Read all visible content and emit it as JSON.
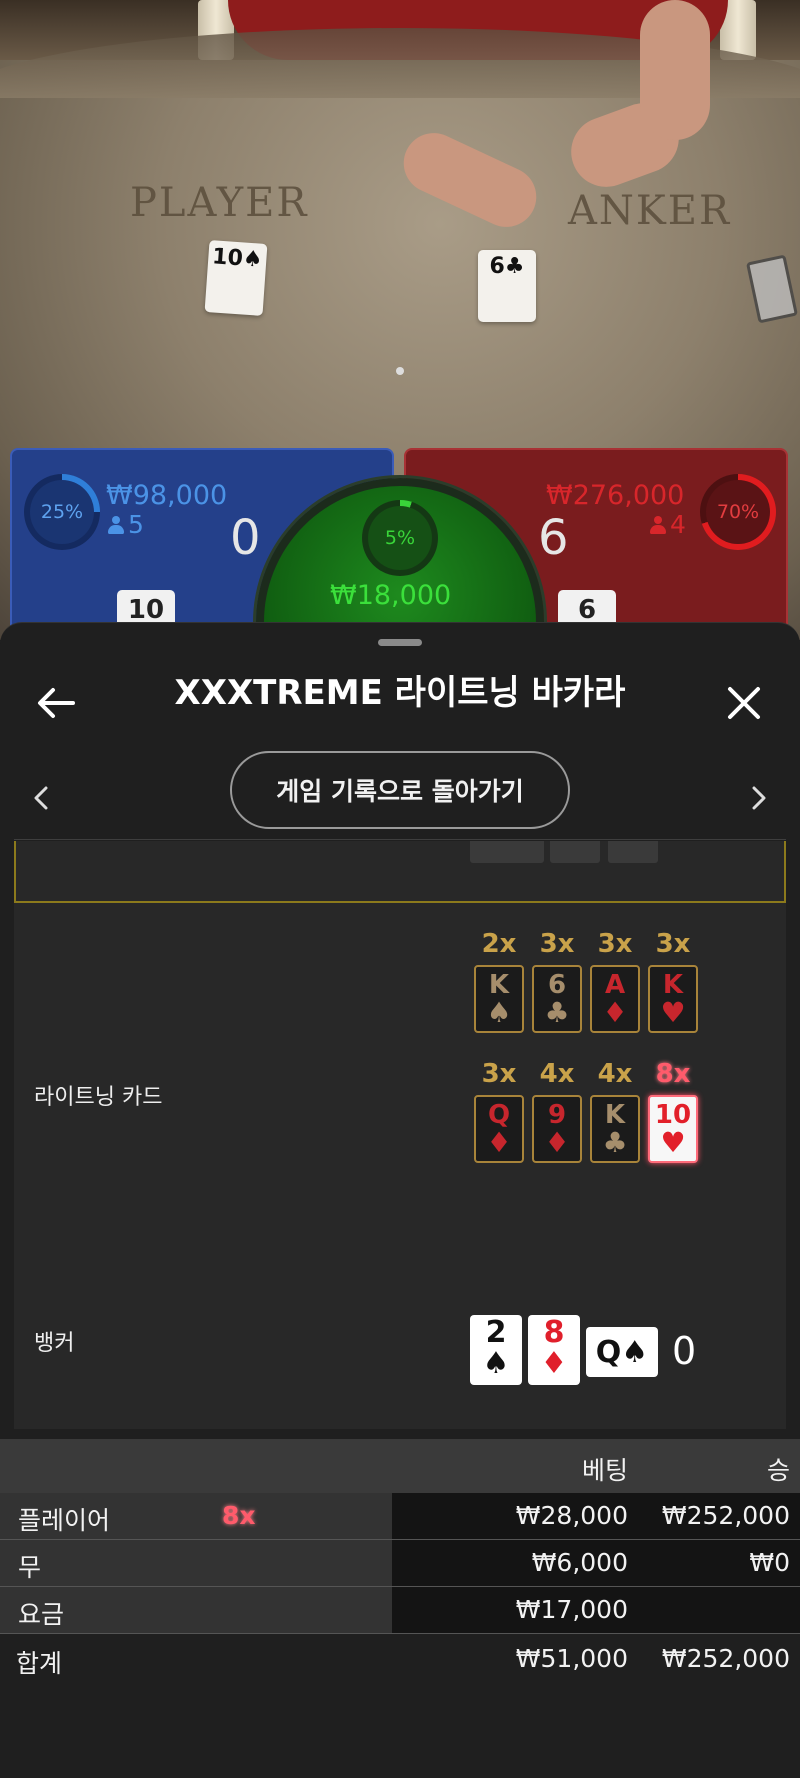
{
  "video": {
    "player_label": "PLAYER",
    "banker_label": "ANKER",
    "player_card": "10♠",
    "banker_card": "6♣"
  },
  "player_panel": {
    "percent": "25%",
    "amount": "₩98,000",
    "count": "5",
    "score": "0",
    "card": "10",
    "color": "#24408a"
  },
  "banker_panel": {
    "percent": "70%",
    "amount": "₩276,000",
    "count": "4",
    "score": "6",
    "card": "6",
    "color": "#7a1c1e"
  },
  "tie_panel": {
    "percent": "5%",
    "amount": "₩18,000",
    "color": "#1e8a1e"
  },
  "sheet": {
    "title": "XXXTREME 라이트닝 바카라",
    "back_icon": "arrow-left-icon",
    "close_icon": "close-icon",
    "return_button": "게임 기록으로 돌아가기"
  },
  "lightning": {
    "label": "라이트닝 카드",
    "cards": [
      {
        "mult": "2x",
        "rank": "K",
        "suit": "♠",
        "color": "dark"
      },
      {
        "mult": "3x",
        "rank": "6",
        "suit": "♣",
        "color": "dark"
      },
      {
        "mult": "3x",
        "rank": "A",
        "suit": "♦",
        "color": "red"
      },
      {
        "mult": "3x",
        "rank": "K",
        "suit": "♥",
        "color": "red"
      },
      {
        "mult": "3x",
        "rank": "Q",
        "suit": "♦",
        "color": "red"
      },
      {
        "mult": "4x",
        "rank": "9",
        "suit": "♦",
        "color": "red"
      },
      {
        "mult": "4x",
        "rank": "K",
        "suit": "♣",
        "color": "dark"
      },
      {
        "mult": "8x",
        "rank": "10",
        "suit": "♥",
        "color": "hot"
      }
    ]
  },
  "banker_row": {
    "label": "뱅커",
    "cards": [
      {
        "rank": "2",
        "suit": "♠",
        "color": "blk"
      },
      {
        "rank": "8",
        "suit": "♦",
        "color": "red"
      }
    ],
    "horizontal_card": "Q♠",
    "score": "0"
  },
  "results": {
    "headers": {
      "bet": "베팅",
      "win": "승"
    },
    "rows": [
      {
        "label": "플레이어",
        "mult": "8x",
        "bet": "₩28,000",
        "win": "₩252,000"
      },
      {
        "label": "무",
        "mult": "",
        "bet": "₩6,000",
        "win": "₩0"
      },
      {
        "label": "요금",
        "mult": "",
        "bet": "₩17,000",
        "win": ""
      }
    ],
    "total": {
      "label": "합계",
      "bet": "₩51,000",
      "win": "₩252,000"
    }
  },
  "colors": {
    "gold": "#c9a24a",
    "hot": "#ff5b6b",
    "sheet_bg": "#1f1f1f"
  }
}
